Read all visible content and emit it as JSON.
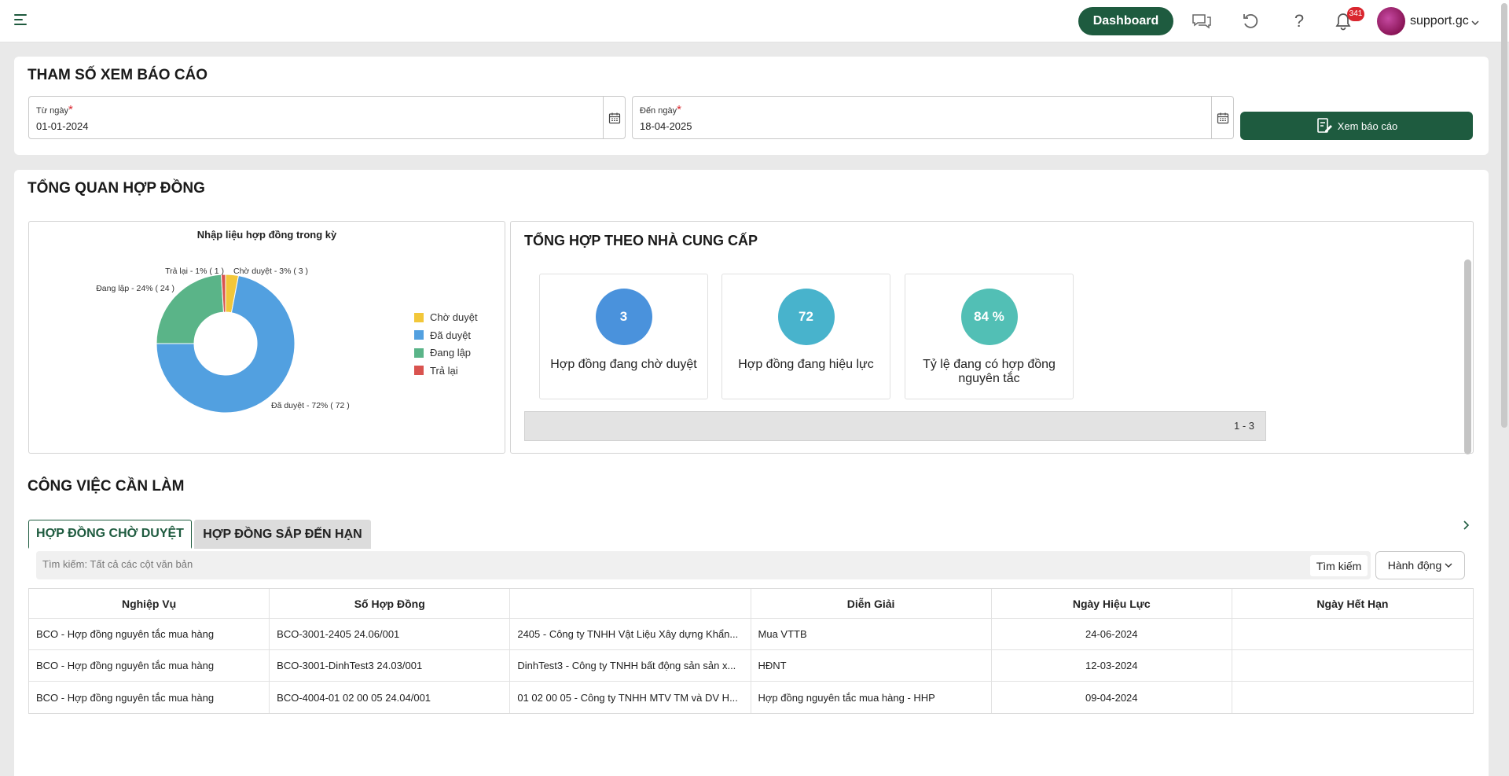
{
  "topbar": {
    "dashboard_label": "Dashboard",
    "notification_count": "341",
    "username": "support.gc"
  },
  "params": {
    "title": "THAM SỐ XEM BÁO CÁO",
    "from_label": "Từ ngày",
    "from_value": "01-01-2024",
    "to_label": "Đến ngày",
    "to_value": "18-04-2025",
    "required_mark": "*",
    "view_button": "Xem báo cáo"
  },
  "overview": {
    "title": "TỔNG QUAN HỢP ĐỒNG",
    "pie_title": "Nhập liệu hợp đồng trong kỳ",
    "summary_title": "TỔNG HỢP THEO NHÀ CUNG CẤP",
    "stats": [
      {
        "value": "3",
        "label": "Hợp đồng đang chờ duyệt",
        "color": "#4a92dc"
      },
      {
        "value": "72",
        "label": "Hợp đồng đang hiệu lực",
        "color": "#48b3cc"
      },
      {
        "value": "84 %",
        "label": "Tỷ lệ đang có hợp đồng nguyên tắc",
        "color": "#52bfb5"
      }
    ],
    "pager_text": "1 - 3"
  },
  "chart_data": {
    "type": "pie",
    "title": "Nhập liệu hợp đồng trong kỳ",
    "donut": true,
    "legend_position": "right",
    "slices": [
      {
        "name": "Chờ duyệt",
        "value": 3,
        "percent": 3,
        "color": "#f2c73a",
        "label": "Chờ duyệt - 3% ( 3 )"
      },
      {
        "name": "Đã duyệt",
        "value": 72,
        "percent": 72,
        "color": "#52a0e0",
        "label": "Đã duyệt - 72% ( 72 )"
      },
      {
        "name": "Đang lập",
        "value": 24,
        "percent": 24,
        "color": "#5ab488",
        "label": "Đang lập - 24% ( 24 )"
      },
      {
        "name": "Trả lại",
        "value": 1,
        "percent": 1,
        "color": "#d9534f",
        "label": "Trả lại - 1% ( 1 )"
      }
    ]
  },
  "tasks": {
    "title": "CÔNG VIỆC CẦN LÀM",
    "tabs": [
      {
        "label": "HỢP ĐỒNG CHỜ DUYỆT"
      },
      {
        "label": "HỢP ĐỒNG SẮP ĐẾN HẠN"
      }
    ],
    "search_placeholder": "Tìm kiếm: Tất cả các cột văn bản",
    "search_button": "Tìm kiếm",
    "action_button": "Hành động",
    "columns": [
      "Nghiệp Vụ",
      "Số Hợp Đồng",
      "",
      "Diễn Giải",
      "Ngày Hiệu Lực",
      "Ngày Hết Hạn"
    ],
    "rows": [
      [
        "BCO - Hợp đồng nguyên tắc mua hàng",
        "BCO-3001-2405 24.06/001",
        "2405 - Công ty TNHH Vật Liệu Xây dựng Khẩn...",
        "Mua VTTB",
        "24-06-2024",
        ""
      ],
      [
        "BCO - Hợp đồng nguyên tắc mua hàng",
        "BCO-3001-DinhTest3 24.03/001",
        "DinhTest3 - Công ty TNHH bất động sản sản x...",
        "HĐNT",
        "12-03-2024",
        ""
      ],
      [
        "BCO - Hợp đồng nguyên tắc mua hàng",
        "BCO-4004-01 02 00 05 24.04/001",
        "01 02 00 05 - Công ty TNHH MTV TM và DV H...",
        "Hợp đồng nguyên tắc mua hàng - HHP",
        "09-04-2024",
        ""
      ]
    ]
  }
}
